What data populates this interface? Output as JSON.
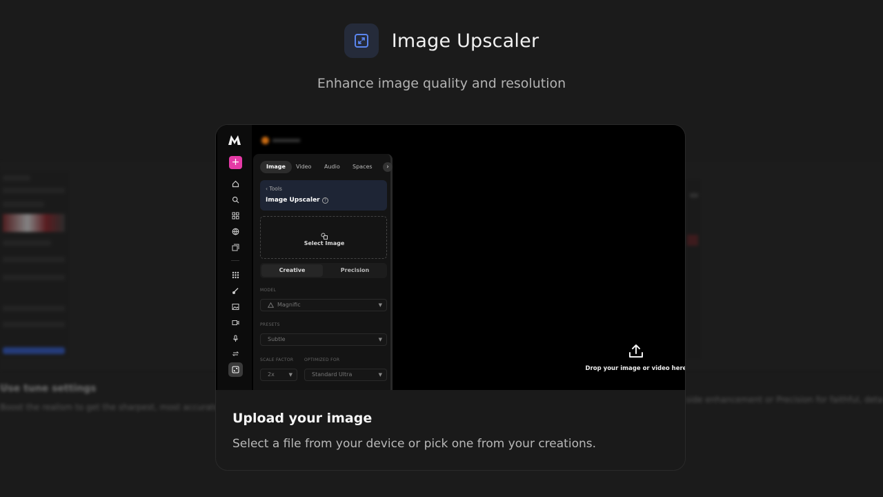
{
  "header": {
    "title": "Image Upscaler",
    "subtitle": "Enhance image quality and resolution"
  },
  "card": {
    "title": "Upload your image",
    "description": "Select a file from your device or pick one from your creations."
  },
  "preview": {
    "tabs": [
      "Image",
      "Video",
      "Audio",
      "Spaces"
    ],
    "tool_back": "Tools",
    "tool_name": "Image Upscaler",
    "select_image": "Select Image",
    "modes": [
      "Creative",
      "Precision"
    ],
    "model_label": "MODEL",
    "model_value": "Magnific",
    "presets_label": "PRESETS",
    "presets_value": "Subtle",
    "scale_label": "SCALE FACTOR",
    "scale_value": "2x",
    "optimized_label": "OPTIMIZED FOR",
    "optimized_value": "Standard Ultra",
    "drop_text": "Drop your image or video here"
  },
  "background": {
    "left_title": "Use tune settings",
    "left_text": "Boost the realism to get the sharpest, most accurate",
    "right_text": "side enhancement or Precision for faithful, detai"
  },
  "colors": {
    "background": "#1b1b1b",
    "accent_pink": "#e53aa6",
    "icon_blue": "#5b86f0",
    "tool_card": "#1e2535"
  }
}
